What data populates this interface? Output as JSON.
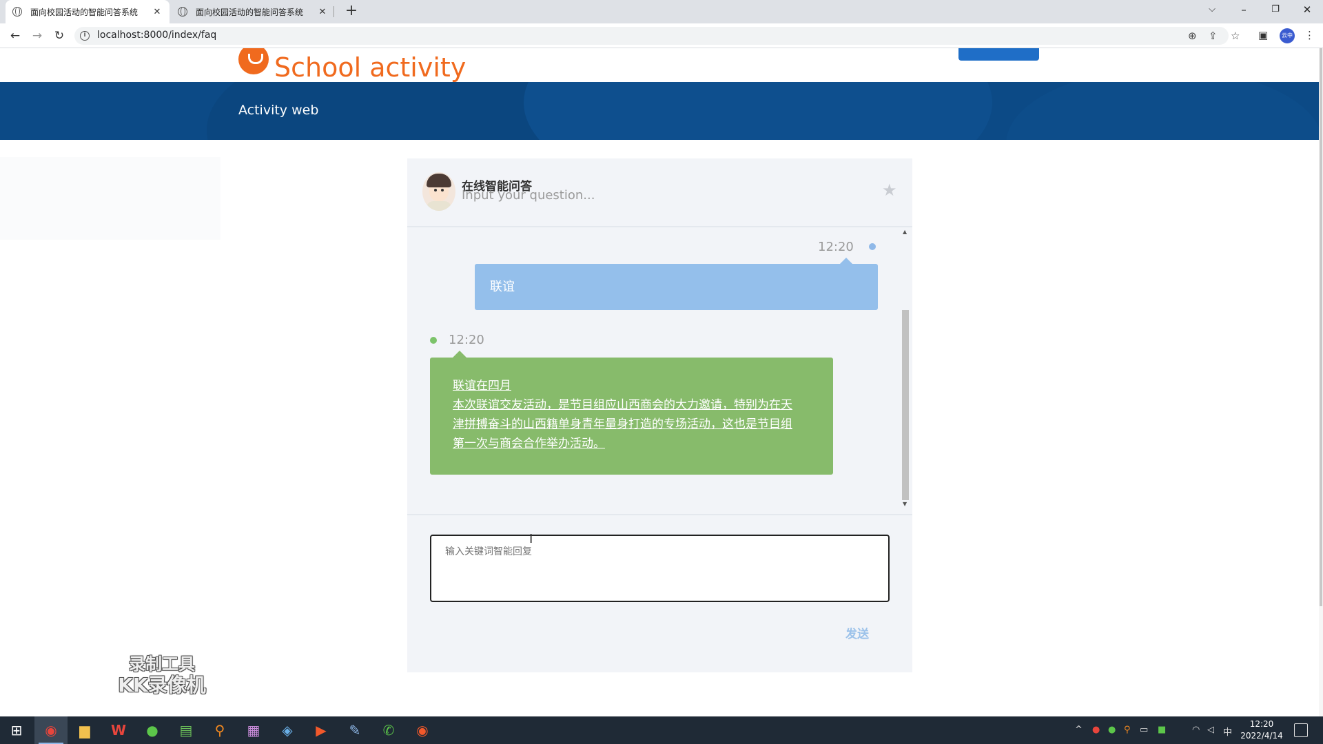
{
  "browser": {
    "tabs": [
      {
        "title": "面向校园活动的智能问答系统",
        "active": true
      },
      {
        "title": "面向校园活动的智能问答系统",
        "active": false
      }
    ],
    "url": "localhost:8000/index/faq",
    "profile_label": "云中"
  },
  "site": {
    "logo_text": "School activity",
    "banner_title": "Activity web"
  },
  "chat": {
    "header_title": "在线智能问答",
    "header_subtitle": "Input your question...",
    "messages": [
      {
        "side": "user",
        "time": "12:20",
        "text": "联谊"
      },
      {
        "side": "bot",
        "time": "12:20",
        "lines": [
          "联谊在四月",
          "本次联谊交友活动，是节目组应山西商会的大力邀请，特别为在天",
          "津拼搏奋斗的山西籍单身青年量身打造的专场活动，这也是节目组",
          "第一次与商会合作举办活动。"
        ]
      }
    ],
    "input_placeholder": "输入关键词智能回复",
    "send_label": "发送"
  },
  "watermark": {
    "line1": "录制工具",
    "line2": "KK录像机"
  },
  "taskbar": {
    "time": "12:20",
    "date": "2022/4/14",
    "ime": "中"
  },
  "colors": {
    "brand_orange": "#f06a1e",
    "banner_blue": "#0c4a86",
    "user_bubble": "#94bfeb",
    "bot_bubble": "#87bb6b",
    "send_text": "#9cc2ea"
  }
}
